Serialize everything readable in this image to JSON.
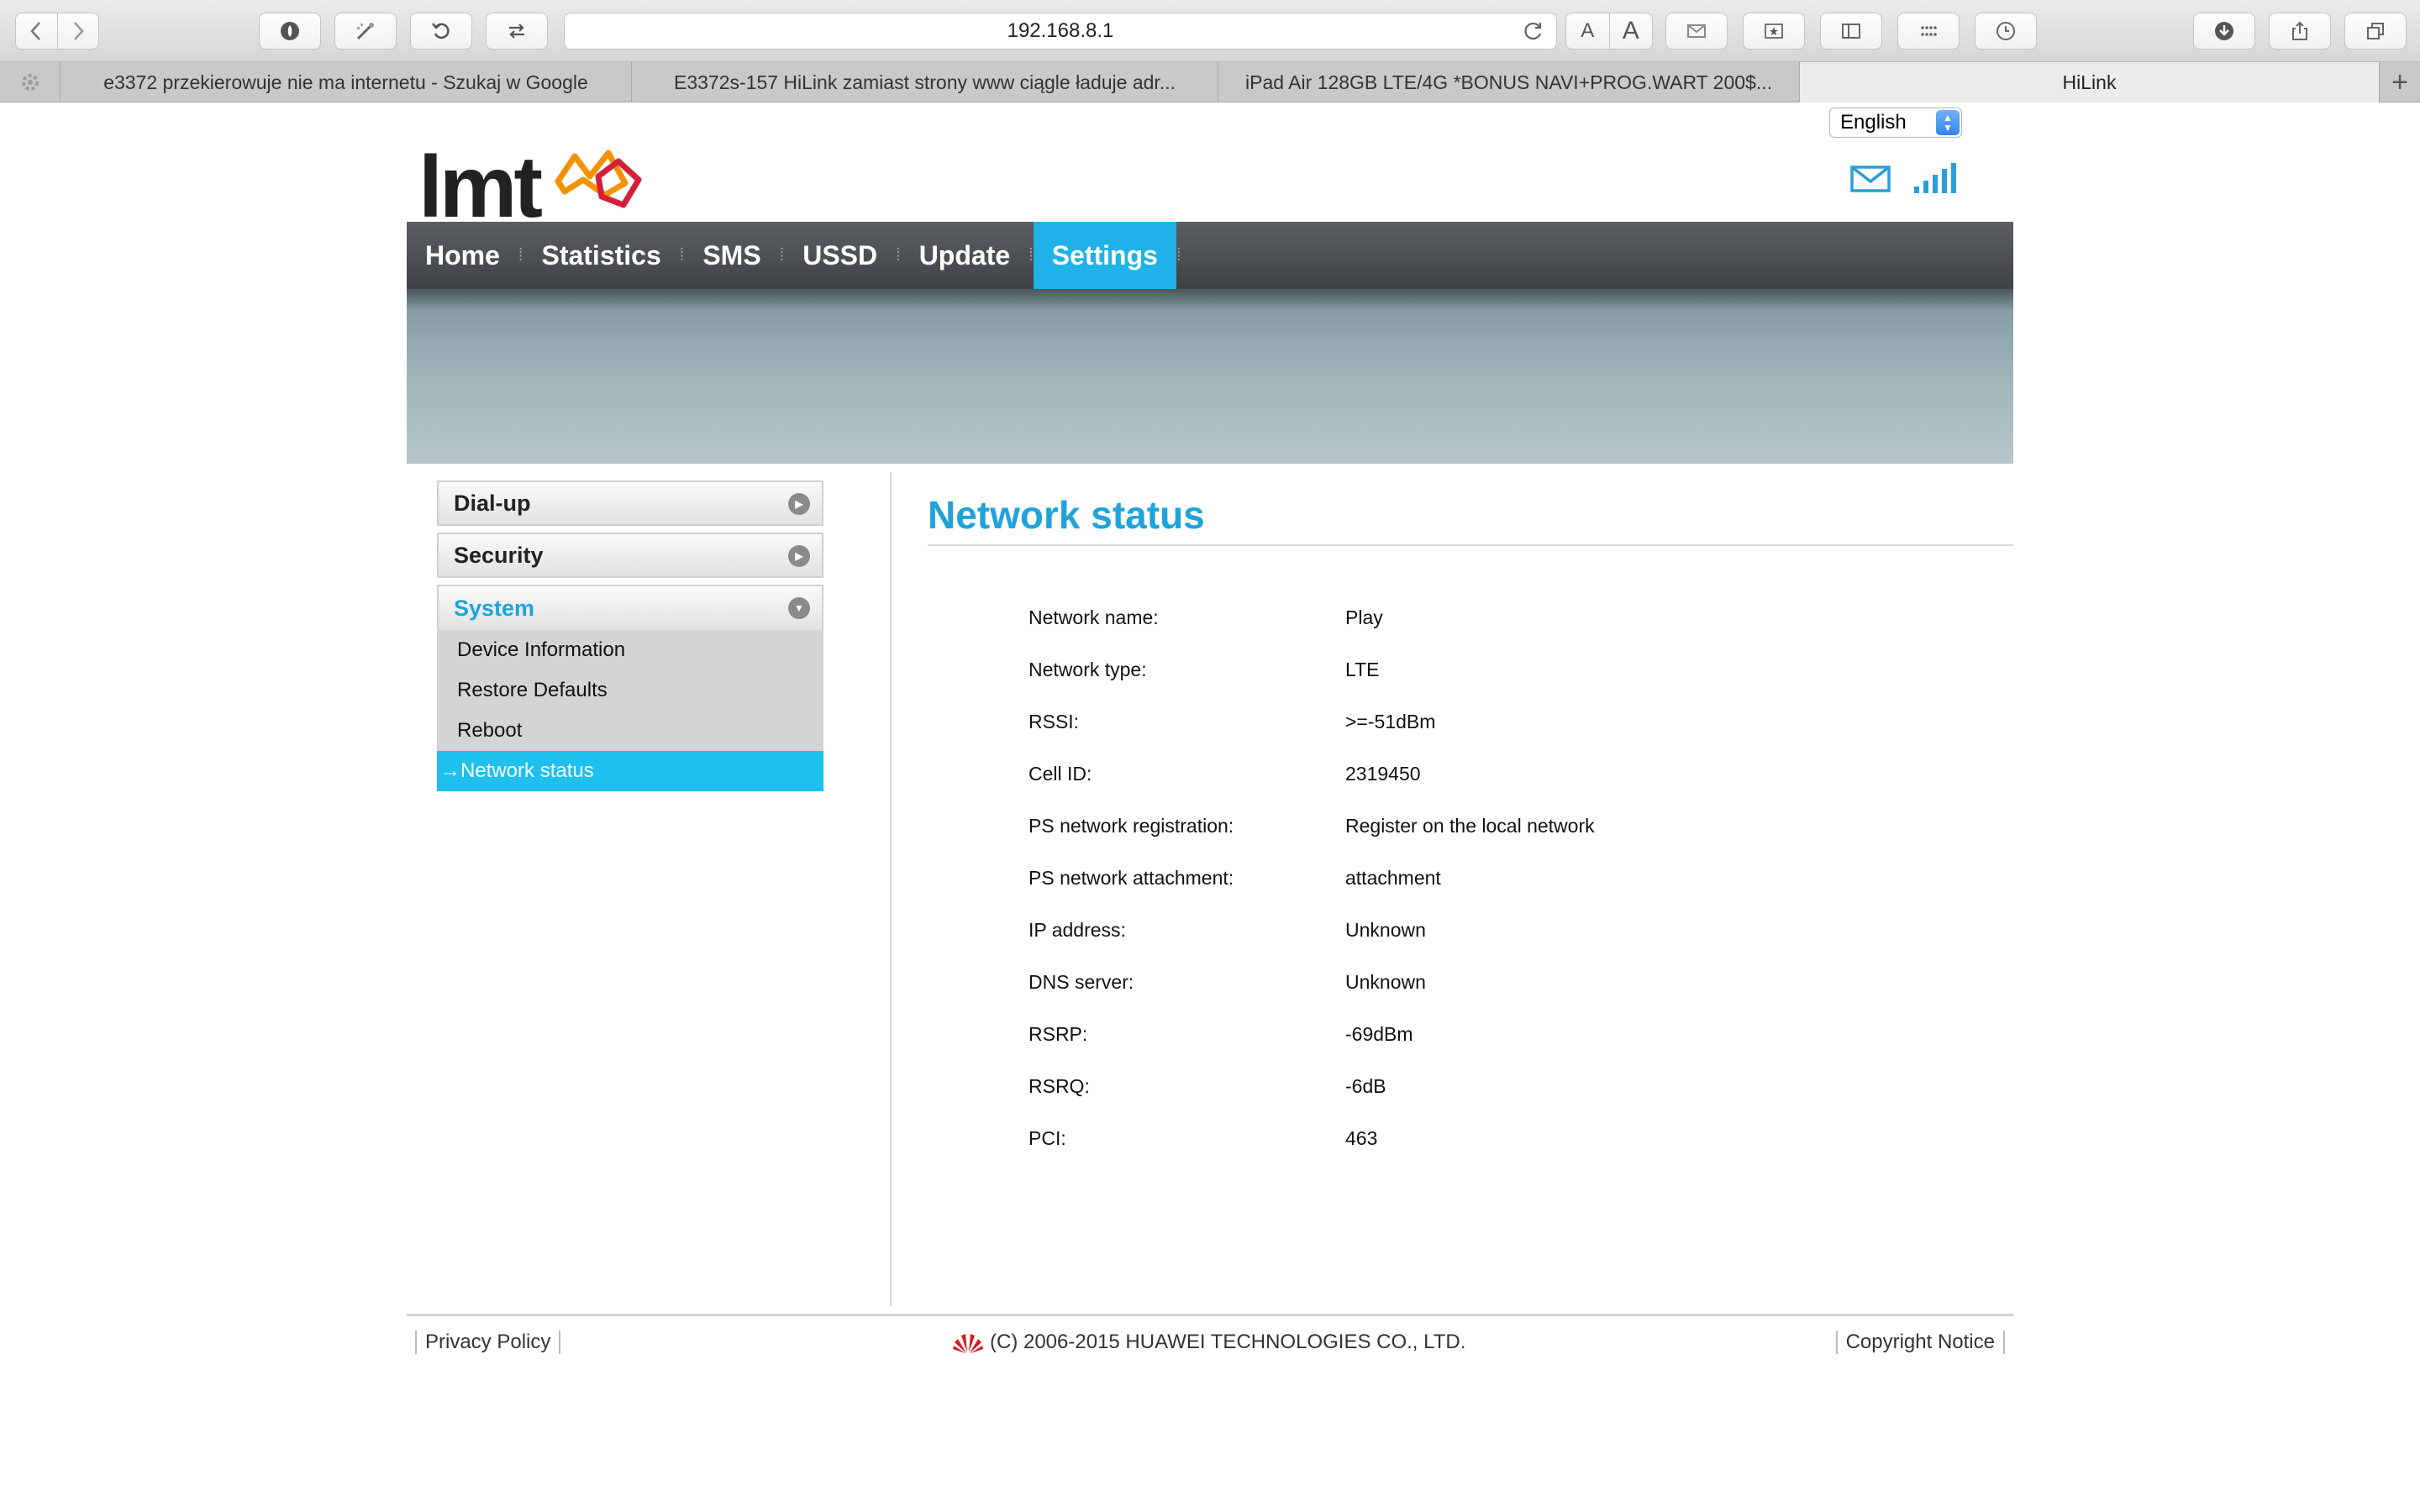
{
  "browser": {
    "url": "192.168.8.1",
    "text_small": "A",
    "text_large": "A",
    "tabs": [
      {
        "label": "e3372 przekierowuje nie ma internetu - Szukaj w Google"
      },
      {
        "label": "E3372s-157 HiLink zamiast strony www ciągle ładuje adr..."
      },
      {
        "label": "iPad Air 128GB LTE/4G *BONUS NAVI+PROG.WART 200$..."
      },
      {
        "label": "HiLink"
      }
    ],
    "new_tab": "+"
  },
  "language": {
    "selected": "English"
  },
  "nav": {
    "items": [
      {
        "label": "Home"
      },
      {
        "label": "Statistics"
      },
      {
        "label": "SMS"
      },
      {
        "label": "USSD"
      },
      {
        "label": "Update"
      },
      {
        "label": "Settings"
      }
    ],
    "active": "Settings"
  },
  "sidebar": {
    "sections": [
      {
        "label": "Dial-up"
      },
      {
        "label": "Security"
      },
      {
        "label": "System"
      }
    ],
    "system_items": [
      {
        "label": "Device Information"
      },
      {
        "label": "Restore Defaults"
      },
      {
        "label": "Reboot"
      },
      {
        "label": "→Network status"
      }
    ]
  },
  "content": {
    "title": "Network status",
    "rows": [
      {
        "label": "Network name:",
        "value": "Play"
      },
      {
        "label": "Network type:",
        "value": "LTE"
      },
      {
        "label": "RSSI:",
        "value": ">=-51dBm"
      },
      {
        "label": "Cell ID:",
        "value": "2319450"
      },
      {
        "label": "PS network registration:",
        "value": "Register on the local network"
      },
      {
        "label": "PS network attachment:",
        "value": "attachment"
      },
      {
        "label": "IP address:",
        "value": "Unknown"
      },
      {
        "label": "DNS server:",
        "value": "Unknown"
      },
      {
        "label": "RSRP:",
        "value": "-69dBm"
      },
      {
        "label": "RSRQ:",
        "value": "-6dB"
      },
      {
        "label": "PCI:",
        "value": "463"
      }
    ]
  },
  "footer": {
    "privacy": "Privacy Policy",
    "copyright": "(C) 2006-2015 HUAWEI TECHNOLOGIES CO., LTD.",
    "notice": "Copyright Notice"
  },
  "colors": {
    "accent": "#1fb2e8",
    "title": "#1fa3d9",
    "nav_bg": "#4a4e51",
    "sidebar_active": "#1fc0ee"
  }
}
